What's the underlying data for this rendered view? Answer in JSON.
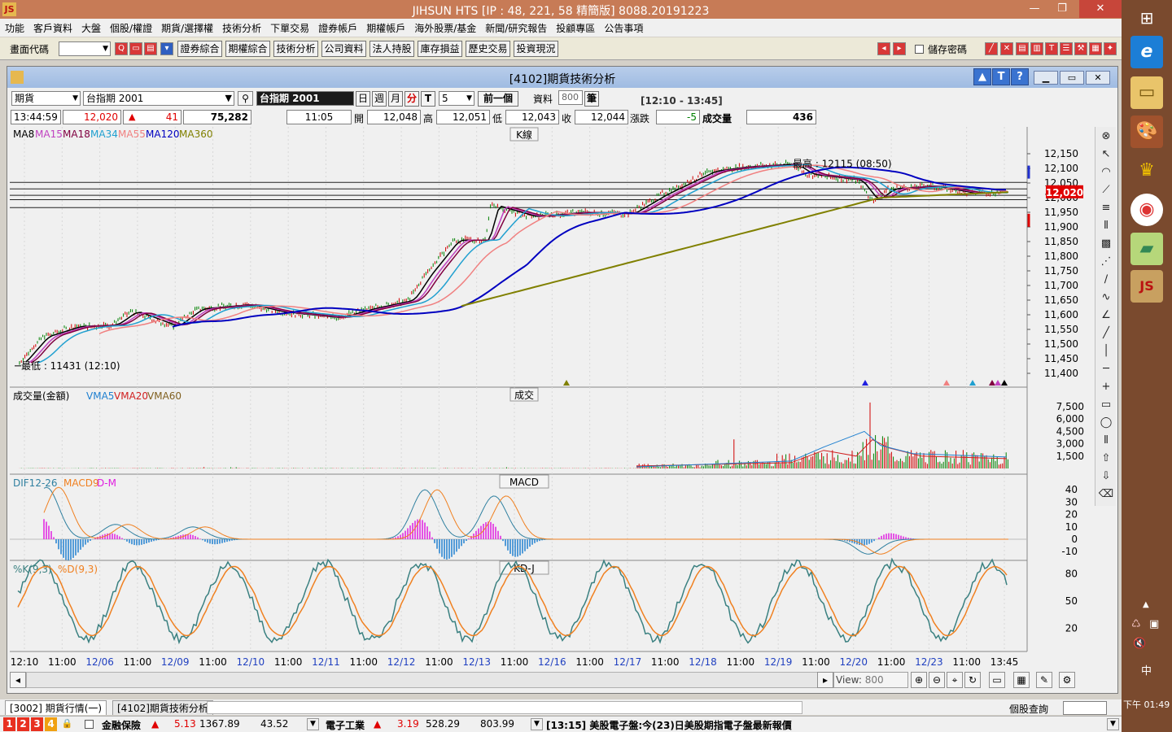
{
  "window": {
    "title": "JIHSUN HTS     [IP : 48, 221, 58 精簡版] 8088.20191223",
    "logo_text": "JS"
  },
  "menu": [
    "功能",
    "客戶資料",
    "大盤",
    "個股/權證",
    "期貨/選擇權",
    "技術分析",
    "下單交易",
    "證券帳戶",
    "期權帳戶",
    "海外股票/基金",
    "新聞/研究報告",
    "投顧專區",
    "公告事項"
  ],
  "toolbar": {
    "code_label": "畫面代碼",
    "buttons": [
      "證券綜合",
      "期權綜合",
      "技術分析",
      "公司資料",
      "法人持股",
      "庫存損益",
      "歷史交易",
      "投資現況"
    ],
    "save_password_label": "儲存密碼"
  },
  "child": {
    "title": "[4102]期貨技術分析",
    "type_select": "期貨",
    "symbol_select": "台指期 2001",
    "symbol_name": "台指期 2001",
    "periods": [
      "日",
      "週",
      "月",
      "分"
    ],
    "selected_period": "分",
    "tick_label": "T",
    "interval": "5",
    "prev_button": "前一個",
    "data_label": "資料",
    "data_count": "800",
    "unit_label": "筆",
    "time_range": "[12:10 - 13:45]"
  },
  "quote": {
    "time": "13:44:59",
    "price": "12,020",
    "change": "41",
    "volume": "75,282",
    "bar_time": "11:05",
    "open_label": "開",
    "open": "12,048",
    "high_label": "高",
    "high": "12,051",
    "low_label": "低",
    "low": "12,043",
    "close_label": "收",
    "close": "12,044",
    "chg_label": "漲跌",
    "chg": "-5",
    "vol_label": "成交量",
    "vol": "436"
  },
  "panels": {
    "kline": {
      "title": "K線",
      "ma_labels": [
        {
          "text": "MA8",
          "color": "#000000"
        },
        {
          "text": "MA15",
          "color": "#c040c0"
        },
        {
          "text": "MA18",
          "color": "#800040"
        },
        {
          "text": "MA34",
          "color": "#20a0d0"
        },
        {
          "text": "MA55",
          "color": "#f08080"
        },
        {
          "text": "MA120",
          "color": "#0000c0"
        },
        {
          "text": "MA360",
          "color": "#808000"
        }
      ],
      "high_note": "最高 : 12115 (08:50)",
      "low_note": "最低 : 11431 (12:10)",
      "last_price": "12,020",
      "y_ticks": [
        "12,150",
        "12,100",
        "12,050",
        "12,000",
        "11,950",
        "11,900",
        "11,850",
        "11,800",
        "11,750",
        "11,700",
        "11,650",
        "11,600",
        "11,550",
        "11,500",
        "11,450",
        "11,400"
      ]
    },
    "volume": {
      "title": "成交",
      "labels": [
        {
          "text": "成交量(金額)",
          "color": "#000000"
        },
        {
          "text": "VMA5",
          "color": "#2080d0"
        },
        {
          "text": "VMA20",
          "color": "#d02020"
        },
        {
          "text": "VMA60",
          "color": "#806020"
        }
      ],
      "y_ticks": [
        "7,500",
        "6,000",
        "4,500",
        "3,000",
        "1,500"
      ]
    },
    "macd": {
      "title": "MACD",
      "labels": [
        {
          "text": "DIF12-26",
          "color": "#3080a0"
        },
        {
          "text": "MACD9",
          "color": "#f08020"
        },
        {
          "text": "D-M",
          "color": "#e020e0"
        }
      ],
      "y_ticks": [
        "40",
        "30",
        "20",
        "10",
        "0",
        "-10"
      ]
    },
    "kd": {
      "title": "KD-J",
      "labels": [
        {
          "text": "%K(9,3)",
          "color": "#3a8080"
        },
        {
          "text": "%D(9,3)",
          "color": "#f08020"
        }
      ],
      "y_ticks": [
        "80",
        "50",
        "20"
      ]
    }
  },
  "x_axis": [
    {
      "t": "12:10",
      "c": "#000000"
    },
    {
      "t": "11:00",
      "c": "#000000"
    },
    {
      "t": "12/06",
      "c": "#2040c0"
    },
    {
      "t": "11:00",
      "c": "#000000"
    },
    {
      "t": "12/09",
      "c": "#2040c0"
    },
    {
      "t": "11:00",
      "c": "#000000"
    },
    {
      "t": "12/10",
      "c": "#2040c0"
    },
    {
      "t": "11:00",
      "c": "#000000"
    },
    {
      "t": "12/11",
      "c": "#2040c0"
    },
    {
      "t": "11:00",
      "c": "#000000"
    },
    {
      "t": "12/12",
      "c": "#2040c0"
    },
    {
      "t": "11:00",
      "c": "#000000"
    },
    {
      "t": "12/13",
      "c": "#2040c0"
    },
    {
      "t": "11:00",
      "c": "#000000"
    },
    {
      "t": "12/16",
      "c": "#2040c0"
    },
    {
      "t": "11:00",
      "c": "#000000"
    },
    {
      "t": "12/17",
      "c": "#2040c0"
    },
    {
      "t": "11:00",
      "c": "#000000"
    },
    {
      "t": "12/18",
      "c": "#2040c0"
    },
    {
      "t": "11:00",
      "c": "#000000"
    },
    {
      "t": "12/19",
      "c": "#2040c0"
    },
    {
      "t": "11:00",
      "c": "#000000"
    },
    {
      "t": "12/20",
      "c": "#2040c0"
    },
    {
      "t": "11:00",
      "c": "#000000"
    },
    {
      "t": "12/23",
      "c": "#2040c0"
    },
    {
      "t": "11:00",
      "c": "#000000"
    },
    {
      "t": "13:45",
      "c": "#000000"
    }
  ],
  "view_label": "View:",
  "view_value": "800",
  "tabs": [
    "[3002] 期貨行情(一)",
    "[4102]期貨技術分析"
  ],
  "stock_query_label": "個股查詢",
  "status": {
    "pages": [
      "1",
      "2",
      "3",
      "4"
    ],
    "sector1_name": "金融保險",
    "sector1_pct": "5.13",
    "sector1_index": "1367.89",
    "sector1_chg": "43.52",
    "sector2_name": "電子工業",
    "sector2_pct": "3.19",
    "sector2_index": "528.29",
    "sector2_chg": "803.99",
    "news": "[13:15] 美股電子盤:今(23)日美股期指電子盤最新報價"
  },
  "clock": {
    "ime": "中",
    "time": "下午 01:49"
  }
}
